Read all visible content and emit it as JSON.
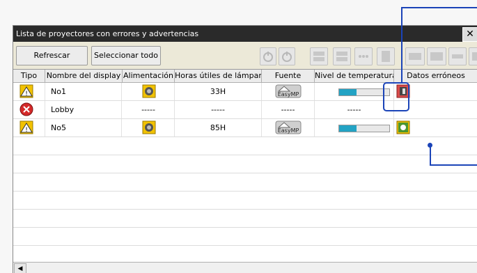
{
  "window": {
    "title": "Lista de proyectores con errores y advertencias",
    "close_glyph": "✕"
  },
  "toolbar": {
    "refresh_label": "Refrescar",
    "select_all_label": "Seleccionar todo",
    "icons": [
      "power-off-icon",
      "power-on-icon",
      "input-computer1-icon",
      "input-computer2-icon",
      "input-video-icon",
      "input-network-icon",
      "input-svideo-icon",
      "input-hdmi-icon",
      "input-usb-icon",
      "mute-icon"
    ]
  },
  "columns": [
    "Tipo",
    "Nombre del display",
    "Alimentación",
    "Horas útiles de lámpara",
    "Fuente",
    "Nivel de temperatura",
    "Datos erróneos"
  ],
  "rows": [
    {
      "type_icon": "warning-icon",
      "name": "No1",
      "power_icon": "lamp-power-icon",
      "lamp_hours": "33H",
      "source_icon": "easymp-icon",
      "temperature_level": 0.35,
      "error_icon": "lamp-cover-error-icon"
    },
    {
      "type_icon": "error-icon",
      "name": "Lobby",
      "power": "-----",
      "lamp_hours": "-----",
      "source": "-----",
      "temperature": "-----"
    },
    {
      "type_icon": "warning-icon",
      "name": "No5",
      "power_icon": "lamp-power-icon",
      "lamp_hours": "85H",
      "source_icon": "easymp-icon",
      "temperature_level": 0.35,
      "error_icon": "fan-error-icon"
    }
  ],
  "colors": {
    "warning": "#f2c200",
    "error": "#d42a2a",
    "accent": "#1b44b8",
    "temp_fill": "#23a3c4"
  }
}
